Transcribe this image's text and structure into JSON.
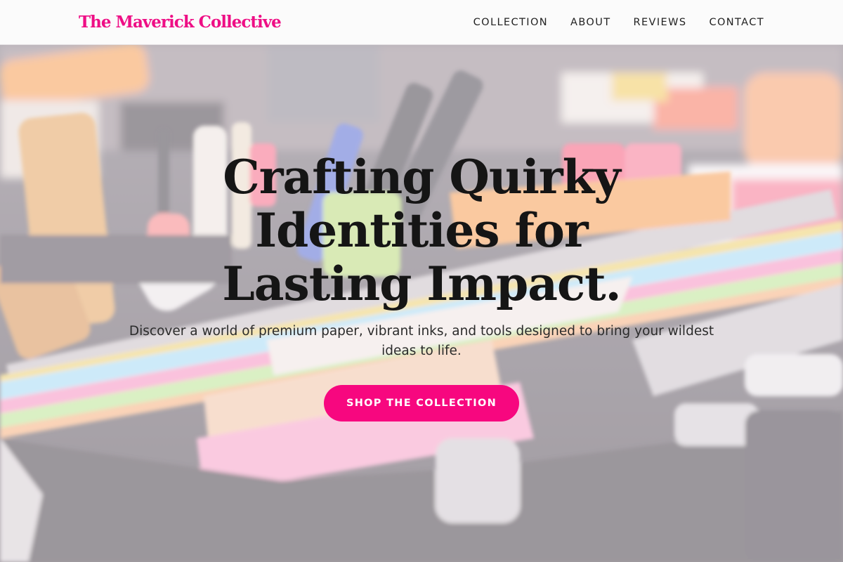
{
  "header": {
    "brand": "The Maverick Collective",
    "nav": [
      "COLLECTION",
      "ABOUT",
      "REVIEWS",
      "CONTACT"
    ]
  },
  "hero": {
    "title": "Crafting Quirky Identities for Lasting Impact.",
    "subtitle": "Discover a world of premium paper, vibrant inks, and tools designed to bring your wildest ideas to life.",
    "cta_label": "SHOP THE COLLECTION",
    "background": "stationery-case-photo"
  },
  "colors": {
    "accent": "#f7077f",
    "brand": "#ee0e85",
    "text": "#151515"
  }
}
